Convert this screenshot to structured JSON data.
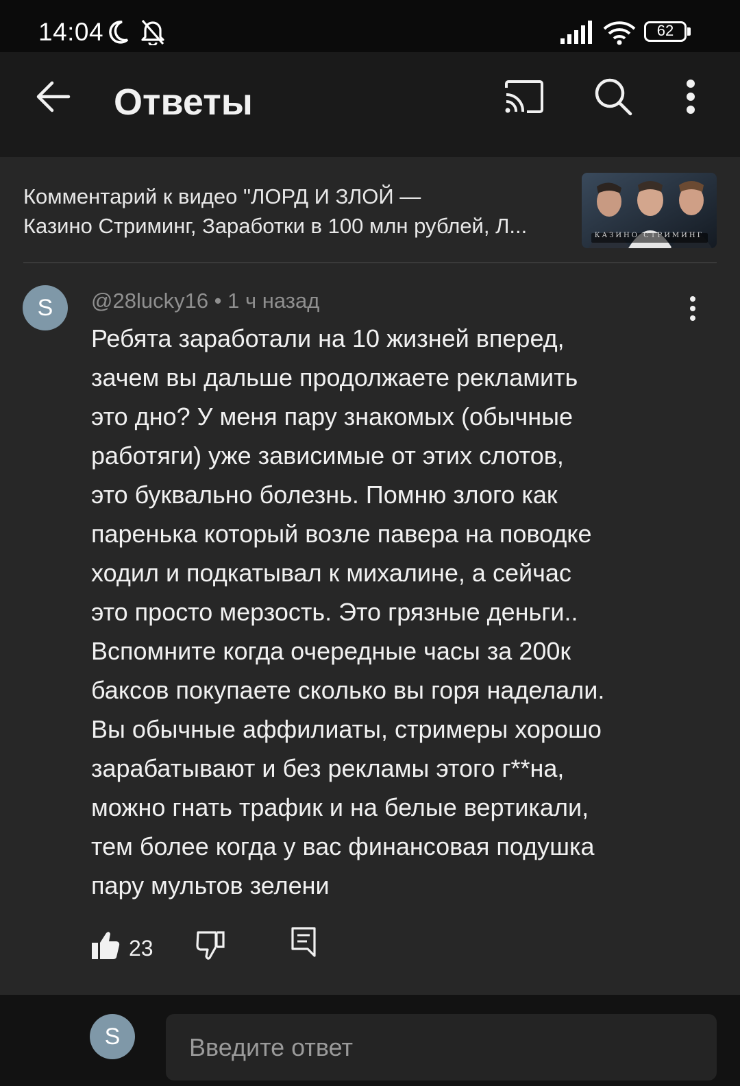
{
  "status": {
    "time": "14:04",
    "battery": "62",
    "icons": [
      "moon-icon",
      "bell-off-icon",
      "signal-icon",
      "wifi-icon",
      "battery-icon"
    ]
  },
  "appbar": {
    "title": "Ответы",
    "icons": [
      "back-arrow-icon",
      "cast-icon",
      "search-icon",
      "more-vert-icon"
    ]
  },
  "video": {
    "title_line1": "Комментарий к видео \"ЛОРД И ЗЛОЙ —",
    "title_line2": "Казино Стриминг, Заработки в 100 млн рублей, Л...",
    "thumbnail_caption": "КАЗИНО СТРИМИНГ"
  },
  "comment": {
    "avatar_letter": "S",
    "author": "@28lucky16",
    "separator": " • ",
    "time": "1 ч назад",
    "lines": [
      "Ребята заработали на 10 жизней вперед,",
      "зачем вы дальше продолжаете рекламить",
      "это дно? У меня пару знакомых (обычные",
      "работяги) уже зависимые от этих слотов,",
      "это буквально болезнь. Помню злого как",
      "паренька который возле павера на поводке",
      "ходил и подкатывал к михалине, а сейчас",
      "это просто мерзость. Это грязные деньги..",
      "Вспомните когда очередные часы за 200к",
      "баксов покупаете сколько вы горя наделали.",
      "Вы обычные аффилиаты, стримеры хорошо",
      "зарабатывают и без рекламы этого г**на,",
      "можно гнать трафик и на белые вертикали,",
      "тем более когда у вас финансовая подушка",
      "пару мультов зелени"
    ],
    "likes": "23"
  },
  "reply": {
    "avatar_letter": "S",
    "placeholder": "Введите ответ"
  },
  "colors": {
    "background": "#0f0f0f",
    "content_bg": "#272727",
    "appbar_bg": "#1a1a1a",
    "avatar": "#7f98a8",
    "text": "#f1f1f1",
    "secondary_text": "#8f8f8f"
  }
}
